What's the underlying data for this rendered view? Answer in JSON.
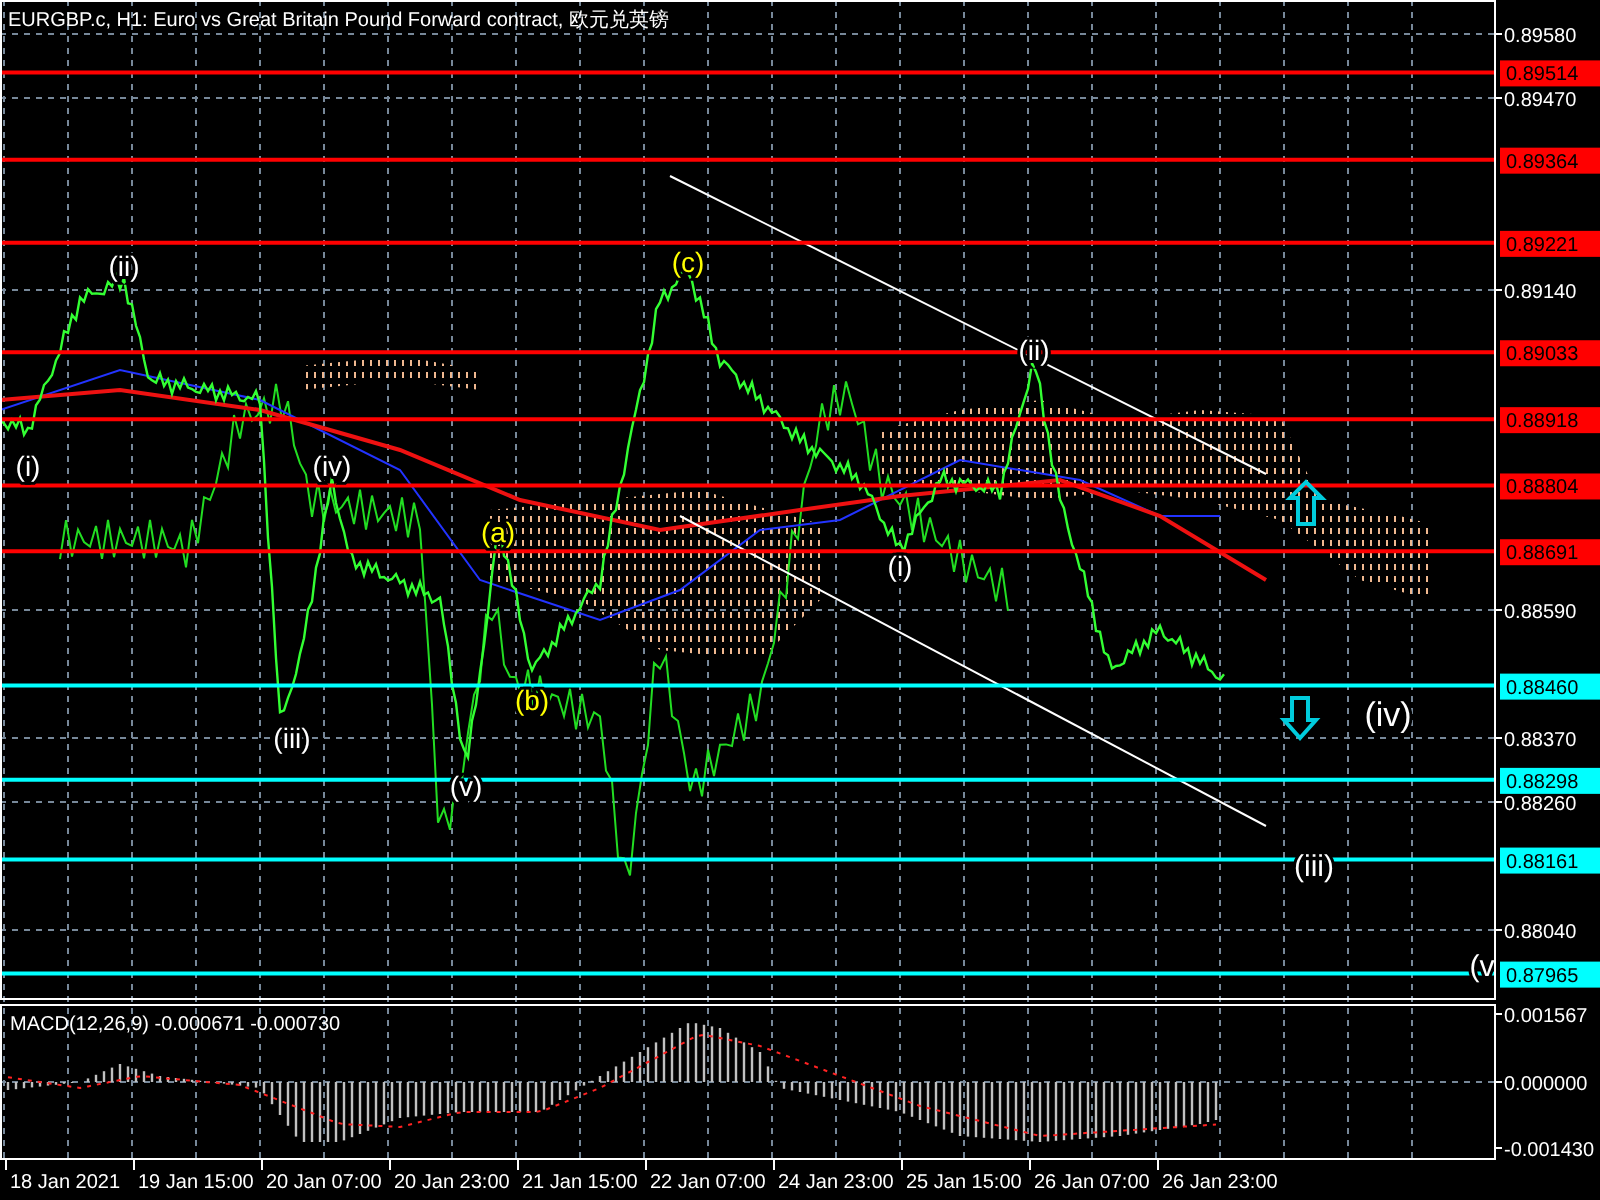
{
  "title": "EURGBP.c, H1:  Euro vs Great Britain Pound Forward contract, 欧元兑英镑",
  "price_axis": [
    "0.89580",
    "0.89470",
    "0.89140",
    "0.88590",
    "0.88370",
    "0.88260",
    "0.88040"
  ],
  "price_levels": [
    {
      "price": "0.89514",
      "color": "#ff0000"
    },
    {
      "price": "0.89364",
      "color": "#ff0000"
    },
    {
      "price": "0.89221",
      "color": "#ff0000"
    },
    {
      "price": "0.89033",
      "color": "#ff0000"
    },
    {
      "price": "0.88918",
      "color": "#ff0000"
    },
    {
      "price": "0.88804",
      "color": "#ff0000"
    },
    {
      "price": "0.88691",
      "color": "#ff0000"
    },
    {
      "price": "0.88460",
      "color": "#00ffff"
    },
    {
      "price": "0.88298",
      "color": "#00ffff"
    },
    {
      "price": "0.88161",
      "color": "#00ffff"
    },
    {
      "price": "0.87965",
      "color": "#00ffff"
    }
  ],
  "wave_labels": [
    {
      "text": "(i)",
      "color": "#ffffff"
    },
    {
      "text": "(ii)",
      "color": "#ffffff"
    },
    {
      "text": "(iv)",
      "color": "#ffffff"
    },
    {
      "text": "(iii)",
      "color": "#ffffff"
    },
    {
      "text": "(v)",
      "color": "#ffffff"
    },
    {
      "text": "(a)",
      "color": "#ffff00"
    },
    {
      "text": "(b)",
      "color": "#ffff00"
    },
    {
      "text": "(c)",
      "color": "#ffff00"
    },
    {
      "text": "(ii)",
      "color": "#ffffff"
    },
    {
      "text": "(i)",
      "color": "#ffffff"
    },
    {
      "text": "(iv)",
      "color": "#ffffff"
    },
    {
      "text": "(iii)",
      "color": "#ffffff"
    },
    {
      "text": "(v",
      "color": "#ffffff"
    }
  ],
  "macd": {
    "label": "MACD(12,26,9) -0.000671 -0.000730",
    "axis": [
      "0.001567",
      "0.000000",
      "-0.001430"
    ]
  },
  "time_axis": [
    "18 Jan 2021",
    "19 Jan 15:00",
    "20 Jan 07:00",
    "20 Jan 23:00",
    "21 Jan 15:00",
    "22 Jan 07:00",
    "24 Jan 23:00",
    "25 Jan 15:00",
    "26 Jan 07:00",
    "26 Jan 23:00"
  ]
}
